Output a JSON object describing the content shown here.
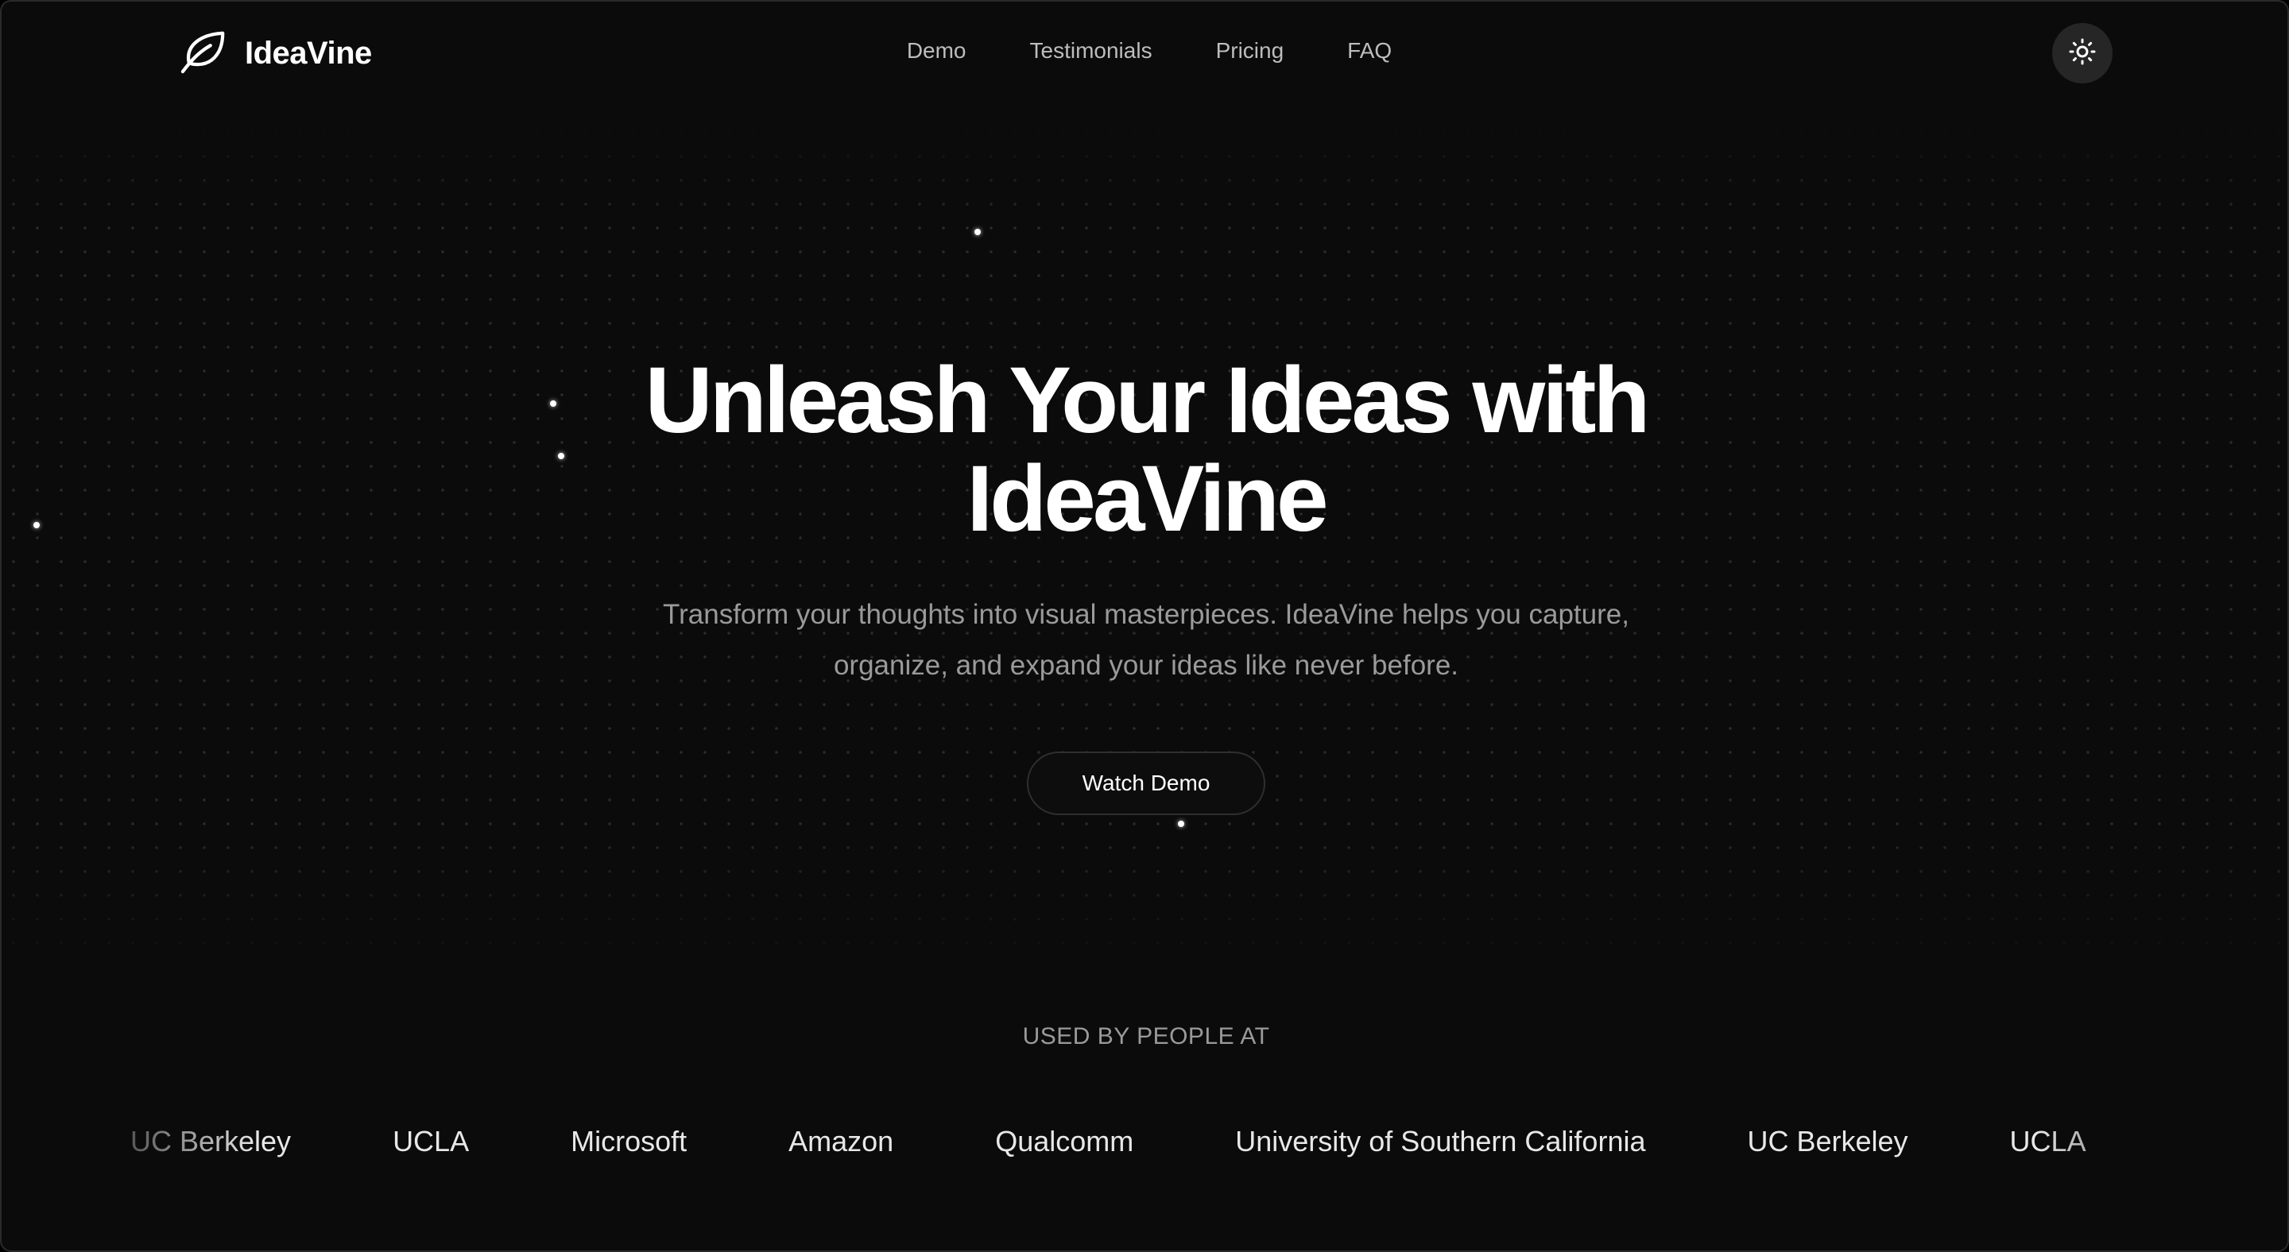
{
  "brand": {
    "name": "IdeaVine",
    "icon": "leaf-icon"
  },
  "nav": {
    "items": [
      {
        "label": "Demo"
      },
      {
        "label": "Testimonials"
      },
      {
        "label": "Pricing"
      },
      {
        "label": "FAQ"
      }
    ]
  },
  "theme_toggle": {
    "icon": "sun-icon"
  },
  "hero": {
    "title_line1": "Unleash Your Ideas with",
    "title_line2": "IdeaVine",
    "subtitle_line1": "Transform your thoughts into visual masterpieces. IdeaVine helps you capture,",
    "subtitle_line2": "organize, and expand your ideas like never before.",
    "cta_label": "Watch Demo"
  },
  "logos": {
    "heading": "USED BY PEOPLE AT",
    "items": [
      "UC Berkeley",
      "UCLA",
      "Microsoft",
      "Amazon",
      "Qualcomm",
      "University of Southern California",
      "UC Berkeley",
      "UCLA"
    ]
  },
  "colors": {
    "background": "#0b0b0b",
    "text_primary": "#ffffff",
    "text_muted": "#9a9a9a",
    "button_border": "#2f2f2f"
  }
}
